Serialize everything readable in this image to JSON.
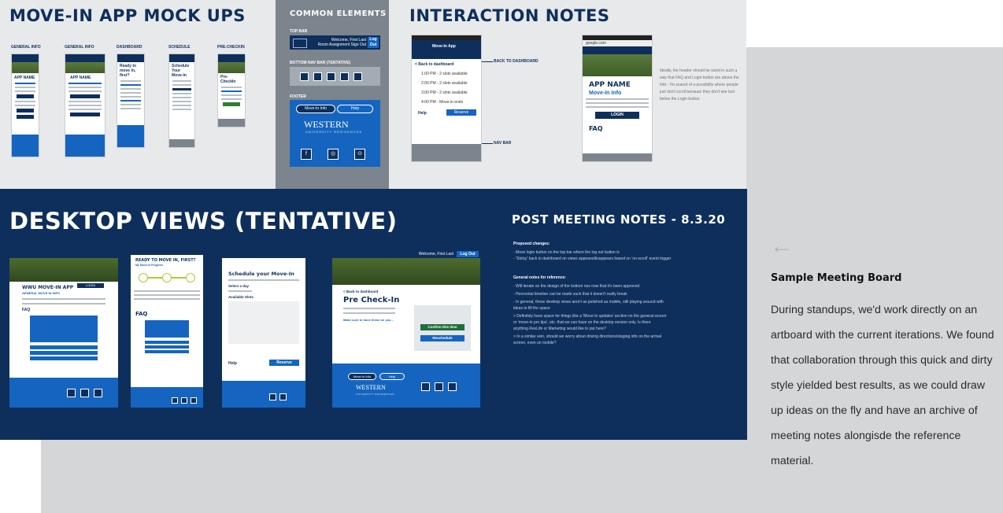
{
  "headings": {
    "mockups": "MOVE-IN APP MOCK UPS",
    "common": "COMMON ELEMENTS",
    "interaction": "INTERACTION NOTES",
    "desktop": "DESKTOP VIEWS (TENTATIVE)",
    "post_meeting": "POST MEETING NOTES - 8.3.20"
  },
  "mockup_labels": [
    "GENERAL INFO",
    "GENERAL INFO",
    "DASHBOARD",
    "SCHEDULE",
    "PRE-CHECKIN"
  ],
  "mockup_titles": [
    "APP NAME",
    "APP NAME",
    "Ready to move in, first?",
    "Schedule Your Move-In",
    "Pre-CheckIn"
  ],
  "common": {
    "top_bar_label": "TOP BAR",
    "bottom_nav_label": "BOTTOM NAV BAR (TENTATIVE)",
    "footer_label": "FOOTER",
    "welcome": "Welcome, First Last",
    "room": "Room Assignment  Sign Out",
    "logout": "Log Out",
    "move_in_info": "Move-In Info",
    "help": "Help",
    "brand": "WESTERN",
    "brand_sub": "UNIVERSITY RESIDENCES"
  },
  "interaction": {
    "app_header": "Move-In App",
    "back_to_dashboard": "BACK TO DASHBOARD",
    "nav_bar": "NAV BAR",
    "back_link": "< Back to dashboard",
    "slots": [
      "1:00 PM - 2 slots available",
      "2:00 PM - 2 slots available",
      "3:00 PM - 2 slots available",
      "4:00 PM - Move-in ends"
    ],
    "help": "Help",
    "reserve": "Reserve",
    "app_name": "APP NAME",
    "move_in_info": "Move-In Info",
    "login": "LOGIN",
    "faq": "FAQ",
    "url": "google.com",
    "header_note": "Ideally, the header should be sized in such a way that FAQ and Login button are above the fold - I'm scared of a possibility where people just don't scroll because they don't see text below the Login button."
  },
  "desktop": {
    "d1_title": "WWU MOVE-IN APP",
    "d1_sub": "GENERAL MOVE IN INFO",
    "d1_faq": "FAQ",
    "d1_login": "LOGIN",
    "d2_title": "READY TO MOVE IN, FIRST?",
    "d2_sub": "My Move-In Progress",
    "d2_faq": "FAQ",
    "d3_title": "Schedule your Move-In",
    "d3_select": "Select a day",
    "d3_avail": "Available Slots",
    "d3_help": "Help",
    "d3_reserve": "Reserve",
    "d4_back": "< Back to dashboard",
    "d4_title": "Pre Check-In",
    "d4_confirm": "Confirm this time",
    "d4_reschedule": "Reschedule",
    "d4_logout": "Log Out",
    "d4_welcome": "Welcome, First Last",
    "d4_make_sure": "Make sure to have these on you...",
    "d4_move_in_info": "Move-In Info",
    "d4_help": "Help",
    "brand": "WESTERN",
    "brand_sub": "UNIVERSITY RESIDENCES"
  },
  "post_meeting": {
    "proposed": "Proposed changes:",
    "proposed_items": [
      "- Move login button on the top bar where the log out button is",
      "- 'Sticky' back to dashboard on views appears/disappears based on 'on-scroll' event trigger"
    ],
    "general": "General notes for reference:",
    "general_items": [
      "- Will iterate on the design of the bottom nav now that it's been approved",
      "- Horizontal timeline can be made such that it doesn't really break",
      "- In general, these desktop views aren't as polished as mobile, still playing around with",
      "ideas to fill the space",
      "     > Definitely have space for things like a 'Move-In updates' section on the general screen",
      "       or 'move-in pro tips', etc. that we can have on the desktop version only. Is there",
      "       anything ResLife or Marketing would like to put here?",
      "     > In a similar vein, should we worry about driving directions/staging info on the arrival",
      "       screen, even on mobile?"
    ]
  },
  "sidebar": {
    "back_arrow": "←",
    "title": "Sample  Meeting Board",
    "body": "During standups, we'd work directly on an artboard with the current iterations. We found that collaboration through this quick and dirty style yielded best results, as we could draw up ideas on the fly and have an archive of meeting notes alongisde the reference material."
  },
  "colors": {
    "navy": "#0e2f5c",
    "blue": "#1565c0",
    "gray_panel": "#7c858d",
    "light": "#e8e9eb",
    "board": "#d5d6d8"
  }
}
